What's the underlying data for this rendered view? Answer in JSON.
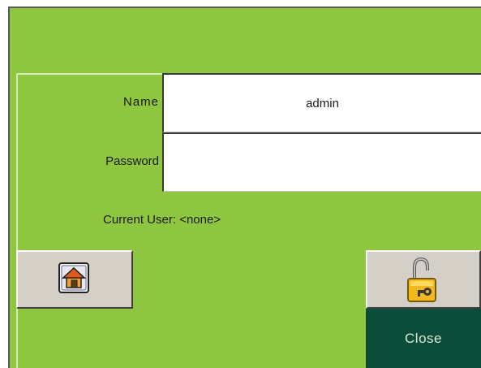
{
  "login": {
    "name_label": "Name",
    "name_value": "admin",
    "password_label": "Password",
    "password_value": "",
    "current_user_text": "Current User: <none>"
  },
  "buttons": {
    "home_icon": "home-icon",
    "login_icon": "padlock-key-icon",
    "close_label": "Close"
  },
  "colors": {
    "panel_background": "#8fc640",
    "close_button_background": "#0b4d3a",
    "button_face": "#d4d0c8"
  }
}
